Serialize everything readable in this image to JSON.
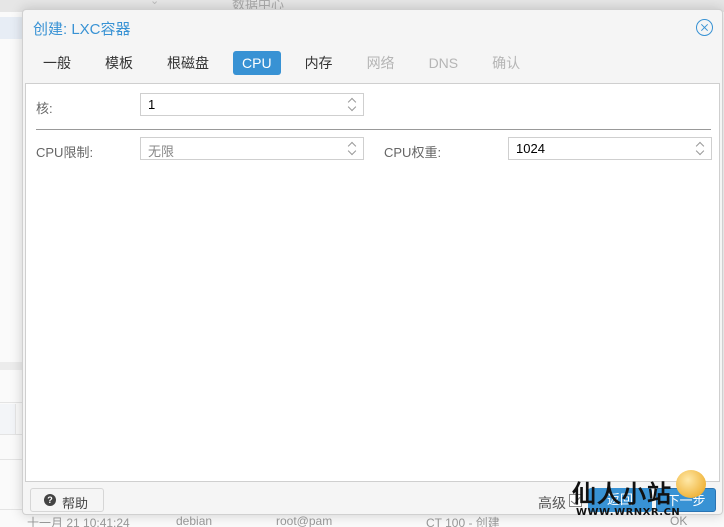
{
  "background": {
    "breadcrumb": "数据中心",
    "log_row": {
      "time": "十一月 21 10:41:24",
      "node": "debian",
      "user": "root@pam",
      "description": "CT 100 - 创建",
      "status": "OK"
    }
  },
  "dialog": {
    "title": "创建: LXC容器",
    "close_icon": "close-circle-icon",
    "tabs": [
      {
        "label": "一般",
        "state": "normal"
      },
      {
        "label": "模板",
        "state": "normal"
      },
      {
        "label": "根磁盘",
        "state": "normal"
      },
      {
        "label": "CPU",
        "state": "active"
      },
      {
        "label": "内存",
        "state": "normal"
      },
      {
        "label": "网络",
        "state": "disabled"
      },
      {
        "label": "DNS",
        "state": "disabled"
      },
      {
        "label": "确认",
        "state": "disabled"
      }
    ],
    "form": {
      "cores": {
        "label": "核:",
        "value": "1"
      },
      "cpu_limit": {
        "label": "CPU限制:",
        "value": "",
        "placeholder": "无限"
      },
      "cpu_units": {
        "label": "CPU权重:",
        "value": "1024"
      }
    },
    "footer": {
      "help_label": "帮助",
      "advanced_label": "高级",
      "advanced_checked": true,
      "back_label": "返回",
      "next_label": "下一步"
    }
  },
  "watermark": {
    "title": "仙人小站",
    "url": "WWW.WRNXR.CN"
  },
  "colors": {
    "accent": "#3892d4",
    "disabled_tab": "#b5b5b5"
  }
}
